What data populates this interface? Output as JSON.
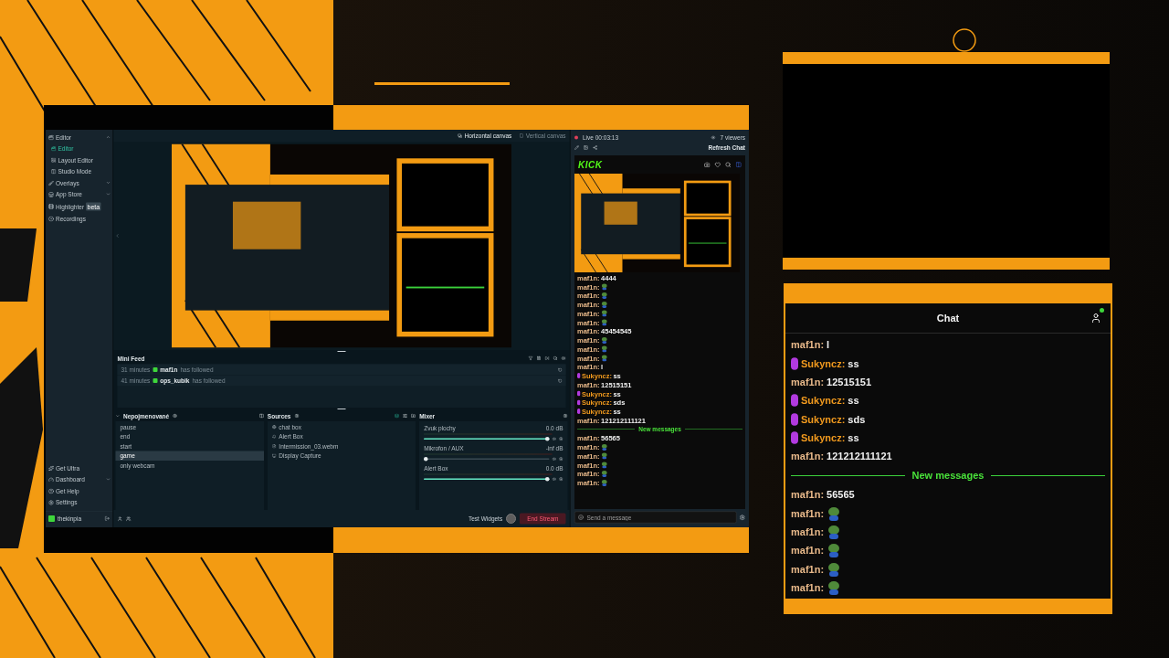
{
  "app": {
    "sidebar": {
      "items": [
        {
          "label": "Editor",
          "expanded": true,
          "children": [
            {
              "label": "Editor",
              "selected": true
            },
            {
              "label": "Layout Editor",
              "selected": false
            },
            {
              "label": "Studio Mode",
              "selected": false
            }
          ]
        },
        {
          "label": "Overlays",
          "expanded": false
        },
        {
          "label": "App Store",
          "expanded": false
        },
        {
          "label": "Highlighter",
          "badge": "beta"
        },
        {
          "label": "Recordings"
        }
      ],
      "bottom_items": [
        {
          "label": "Get Ultra"
        },
        {
          "label": "Dashboard",
          "expanded": false
        },
        {
          "label": "Get Help"
        },
        {
          "label": "Settings"
        }
      ],
      "user": "thekinpia"
    },
    "canvas_tabs": [
      {
        "label": "Horizontal canvas",
        "selected": true
      },
      {
        "label": "Vertical canvas",
        "selected": false
      }
    ],
    "mini_feed": {
      "title": "Mini Feed",
      "events": [
        {
          "time": "31 minutes",
          "user": "maf1n",
          "action": "has followed"
        },
        {
          "time": "41 minutes",
          "user": "ops_kubik",
          "action": "has followed"
        }
      ]
    },
    "scenes": {
      "title": "Nepojmenované",
      "items": [
        {
          "label": "pause",
          "selected": false
        },
        {
          "label": "end",
          "selected": false
        },
        {
          "label": "start",
          "selected": false
        },
        {
          "label": "game",
          "selected": true
        },
        {
          "label": "only webcam",
          "selected": false
        }
      ]
    },
    "sources": {
      "title": "Sources",
      "items": [
        {
          "label": "chat box",
          "kind": "browser"
        },
        {
          "label": "Alert Box",
          "kind": "widget"
        },
        {
          "label": "Intermission_03.webm",
          "kind": "media"
        },
        {
          "label": "Display Capture",
          "kind": "display"
        }
      ]
    },
    "mixer": {
      "title": "Mixer",
      "channels": [
        {
          "name": "Zvuk plochy",
          "reading": "0.0 dB",
          "level": 1
        },
        {
          "name": "Mikrofon / AUX",
          "reading": "-inf dB",
          "level": 0
        },
        {
          "name": "Alert Box",
          "reading": "0.0 dB",
          "level": 1
        }
      ]
    },
    "footer": {
      "test_widgets": "Test Widgets",
      "end_stream": "End Stream"
    },
    "chat_panel": {
      "live": "Live 00:03:13",
      "viewers": "7 viewers",
      "refresh": "Refresh Chat",
      "logo": "KICK",
      "placeholder": "Send a message",
      "messages": [
        {
          "user": "maf1n:",
          "kind": "text",
          "text": "4444",
          "badge": false,
          "color": "#e8b98a"
        },
        {
          "user": "maf1n:",
          "kind": "emote",
          "badge": false,
          "color": "#e8b98a"
        },
        {
          "user": "maf1n:",
          "kind": "emote",
          "badge": false,
          "color": "#e8b98a"
        },
        {
          "user": "maf1n:",
          "kind": "emote",
          "badge": false,
          "color": "#e8b98a"
        },
        {
          "user": "maf1n:",
          "kind": "emote",
          "badge": false,
          "color": "#e8b98a"
        },
        {
          "user": "maf1n:",
          "kind": "emote",
          "badge": false,
          "color": "#e8b98a"
        },
        {
          "user": "maf1n:",
          "kind": "text",
          "text": "45454545",
          "badge": false,
          "color": "#e8b98a"
        },
        {
          "user": "maf1n:",
          "kind": "emote",
          "badge": false,
          "color": "#e8b98a"
        },
        {
          "user": "maf1n:",
          "kind": "emote",
          "badge": false,
          "color": "#e8b98a"
        },
        {
          "user": "maf1n:",
          "kind": "emote",
          "badge": false,
          "color": "#e8b98a"
        },
        {
          "user": "maf1n:",
          "kind": "text",
          "text": "l",
          "badge": false,
          "color": "#e8b98a"
        },
        {
          "user": "Sukyncz:",
          "kind": "text",
          "text": "ss",
          "badge": true,
          "color": "#f29a1e"
        },
        {
          "user": "maf1n:",
          "kind": "text",
          "text": "12515151",
          "badge": false,
          "color": "#e8b98a"
        },
        {
          "user": "Sukyncz:",
          "kind": "text",
          "text": "ss",
          "badge": true,
          "color": "#f29a1e"
        },
        {
          "user": "Sukyncz:",
          "kind": "text",
          "text": "sds",
          "badge": true,
          "color": "#f29a1e"
        },
        {
          "user": "Sukyncz:",
          "kind": "text",
          "text": "ss",
          "badge": true,
          "color": "#f29a1e"
        },
        {
          "user": "maf1n:",
          "kind": "text",
          "text": "121212111121",
          "badge": false,
          "color": "#e8b98a"
        },
        {
          "kind": "divider",
          "text": "New messages"
        },
        {
          "user": "maf1n:",
          "kind": "text",
          "text": "56565",
          "badge": false,
          "color": "#e8b98a"
        },
        {
          "user": "maf1n:",
          "kind": "emote",
          "badge": false,
          "color": "#e8b98a"
        },
        {
          "user": "maf1n:",
          "kind": "emote",
          "badge": false,
          "color": "#e8b98a"
        },
        {
          "user": "maf1n:",
          "kind": "emote",
          "badge": false,
          "color": "#e8b98a"
        },
        {
          "user": "maf1n:",
          "kind": "emote",
          "badge": false,
          "color": "#e8b98a"
        },
        {
          "user": "maf1n:",
          "kind": "emote",
          "badge": false,
          "color": "#e8b98a"
        }
      ]
    }
  },
  "chat_widget": {
    "title": "Chat",
    "messages": [
      {
        "user": "maf1n:",
        "kind": "text",
        "text": "l",
        "badge": false,
        "color": "#e8b98a"
      },
      {
        "user": "Sukyncz:",
        "kind": "text",
        "text": "ss",
        "badge": true,
        "color": "#f29a1e"
      },
      {
        "user": "maf1n:",
        "kind": "text",
        "text": "12515151",
        "badge": false,
        "color": "#e8b98a"
      },
      {
        "user": "Sukyncz:",
        "kind": "text",
        "text": "ss",
        "badge": true,
        "color": "#f29a1e"
      },
      {
        "user": "Sukyncz:",
        "kind": "text",
        "text": "sds",
        "badge": true,
        "color": "#f29a1e"
      },
      {
        "user": "Sukyncz:",
        "kind": "text",
        "text": "ss",
        "badge": true,
        "color": "#f29a1e"
      },
      {
        "user": "maf1n:",
        "kind": "text",
        "text": "121212111121",
        "badge": false,
        "color": "#e8b98a"
      },
      {
        "kind": "divider",
        "text": "New messages"
      },
      {
        "user": "maf1n:",
        "kind": "text",
        "text": "56565",
        "badge": false,
        "color": "#e8b98a"
      },
      {
        "user": "maf1n:",
        "kind": "emote",
        "badge": false,
        "color": "#e8b98a"
      },
      {
        "user": "maf1n:",
        "kind": "emote",
        "badge": false,
        "color": "#e8b98a"
      },
      {
        "user": "maf1n:",
        "kind": "emote",
        "badge": false,
        "color": "#e8b98a"
      },
      {
        "user": "maf1n:",
        "kind": "emote",
        "badge": false,
        "color": "#e8b98a"
      },
      {
        "user": "maf1n:",
        "kind": "emote",
        "badge": false,
        "color": "#e8b98a"
      }
    ]
  }
}
